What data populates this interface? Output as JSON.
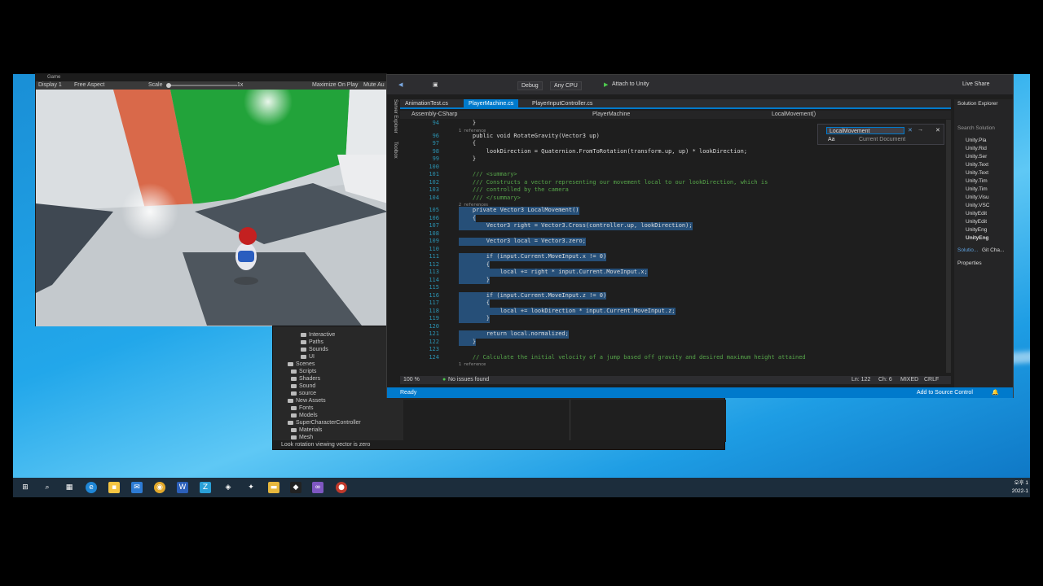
{
  "unity_game": {
    "tab_label": "Game",
    "display": "Display 1",
    "aspect": "Free Aspect",
    "scale_label": "Scale",
    "scale_value": "1x",
    "maximize_label": "Maximize On Play",
    "mute_label": "Mute Au"
  },
  "unity_project": {
    "tree": [
      "Interactive",
      "Paths",
      "Sounds",
      "UI",
      "Scenes",
      "Scripts",
      "Shaders",
      "Sound",
      "source",
      "New Assets",
      "Fonts",
      "Models",
      "SuperCharacterController",
      "Materials",
      "Mesh"
    ],
    "status": "Look rotation viewing vector is zero"
  },
  "vs": {
    "config": "Debug",
    "platform": "Any CPU",
    "attach": "Attach to Unity",
    "live_share": "Live Share",
    "tabs": [
      "AnimationTest.cs",
      "PlayerMachine.cs",
      "PlayerInputController.cs"
    ],
    "nav": {
      "project": "Assembly-CSharp",
      "class": "PlayerMachine",
      "member": "LocalMovement()"
    },
    "find": {
      "query": "LocalMovement",
      "scope": "Current Document",
      "option": "Aa"
    },
    "side_tabs": [
      "Server Explorer",
      "Toolbox"
    ],
    "code_lines": [
      {
        "n": "94",
        "t": "    }",
        "sel": false
      },
      {
        "n": "",
        "t": "1 reference",
        "ref": true
      },
      {
        "n": "96",
        "t": "    public void RotateGravity(Vector3 up)",
        "sel": false
      },
      {
        "n": "97",
        "t": "    {",
        "sel": false
      },
      {
        "n": "98",
        "t": "        lookDirection = Quaternion.FromToRotation(transform.up, up) * lookDirection;",
        "sel": false
      },
      {
        "n": "99",
        "t": "    }",
        "sel": false
      },
      {
        "n": "100",
        "t": "",
        "sel": false
      },
      {
        "n": "101",
        "t": "    /// <summary>",
        "sel": false,
        "cm": true
      },
      {
        "n": "102",
        "t": "    /// Constructs a vector representing our movement local to our lookDirection, which is",
        "sel": false,
        "cm": true
      },
      {
        "n": "103",
        "t": "    /// controlled by the camera",
        "sel": false,
        "cm": true
      },
      {
        "n": "104",
        "t": "    /// </summary>",
        "sel": false,
        "cm": true
      },
      {
        "n": "",
        "t": "2 references",
        "ref": true
      },
      {
        "n": "105",
        "t": "    private Vector3 LocalMovement()",
        "sel": true
      },
      {
        "n": "106",
        "t": "    {",
        "sel": true
      },
      {
        "n": "107",
        "t": "        Vector3 right = Vector3.Cross(controller.up, lookDirection);",
        "sel": true
      },
      {
        "n": "108",
        "t": "",
        "sel": true
      },
      {
        "n": "109",
        "t": "        Vector3 local = Vector3.zero;",
        "sel": true
      },
      {
        "n": "110",
        "t": "",
        "sel": true
      },
      {
        "n": "111",
        "t": "        if (input.Current.MoveInput.x != 0)",
        "sel": true
      },
      {
        "n": "112",
        "t": "        {",
        "sel": true
      },
      {
        "n": "113",
        "t": "            local += right * input.Current.MoveInput.x;",
        "sel": true
      },
      {
        "n": "114",
        "t": "        }",
        "sel": true
      },
      {
        "n": "115",
        "t": "",
        "sel": true
      },
      {
        "n": "116",
        "t": "        if (input.Current.MoveInput.z != 0)",
        "sel": true
      },
      {
        "n": "117",
        "t": "        {",
        "sel": true
      },
      {
        "n": "118",
        "t": "            local += lookDirection * input.Current.MoveInput.z;",
        "sel": true
      },
      {
        "n": "119",
        "t": "        }",
        "sel": true
      },
      {
        "n": "120",
        "t": "",
        "sel": true
      },
      {
        "n": "121",
        "t": "        return local.normalized;",
        "sel": true
      },
      {
        "n": "122",
        "t": "    }",
        "sel": true
      },
      {
        "n": "123",
        "t": "",
        "sel": false
      },
      {
        "n": "124",
        "t": "    // Calculate the initial velocity of a jump based off gravity and desired maximum height attained",
        "sel": false,
        "cm": true
      },
      {
        "n": "",
        "t": "1 reference",
        "ref": true
      }
    ],
    "footer": {
      "zoom": "100 %",
      "issues": "No issues found",
      "ln": "Ln: 122",
      "ch": "Ch: 6",
      "mixed": "MIXED",
      "crlf": "CRLF"
    },
    "status": {
      "ready": "Ready",
      "source_control": "Add to Source Control"
    },
    "solution_explorer": {
      "title": "Solution Explorer",
      "search": "Search Solution",
      "items": [
        "Unity.Pla",
        "Unity.Rid",
        "Unity.Ser",
        "Unity.Text",
        "Unity.Text",
        "Unity.Tim",
        "Unity.Tim",
        "Unity.Visu",
        "Unity.VSC",
        "UnityEdit",
        "UnityEdit",
        "UnityEng",
        "UnityEng"
      ],
      "tabs": [
        "Solutio...",
        "Git Cha..."
      ],
      "properties": "Properties"
    }
  },
  "taskbar": {
    "clock_time": "오후 1",
    "clock_date": "2022-1"
  },
  "colors": {
    "vs_accent": "#007acc",
    "selection": "#264f78",
    "desktop": "#1ea0e6"
  }
}
